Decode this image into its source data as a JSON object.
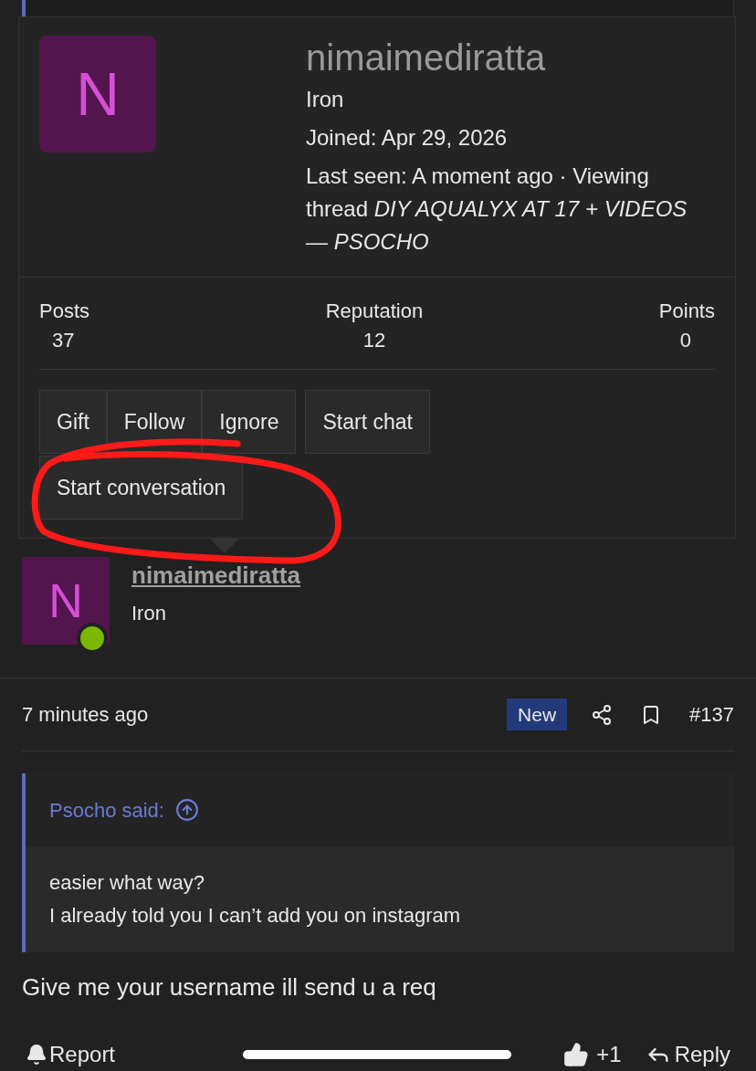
{
  "popup": {
    "avatar_letter": "N",
    "username": "nimaimediratta",
    "rank": "Iron",
    "joined": "Joined: Apr 29, 2026",
    "last_seen": "Last seen: A moment ago · Viewing thread *DIY AQUALYX AT 17 + VIDEOS — PSOCHO*",
    "stats": [
      {
        "label": "Posts",
        "value": "37"
      },
      {
        "label": "Reputation",
        "value": "12"
      },
      {
        "label": "Points",
        "value": "0"
      }
    ],
    "button_groups": [
      [
        "Gift",
        "Follow",
        "Ignore"
      ],
      [
        "Start chat"
      ],
      [
        "Start conversation"
      ]
    ]
  },
  "post": {
    "author": {
      "avatar_letter": "N",
      "username": "nimaimediratta",
      "rank": "Iron",
      "online": true
    },
    "time": "7 minutes ago",
    "badge": "New",
    "number": "#137",
    "quote": {
      "author": "Psocho said:",
      "lines": [
        "easier what way?",
        "I already told you I can’t add you on instagram"
      ]
    },
    "message": "Give me your username ill send u a req",
    "footer": {
      "report": "Report",
      "likes": "+1",
      "reply": "Reply"
    }
  }
}
